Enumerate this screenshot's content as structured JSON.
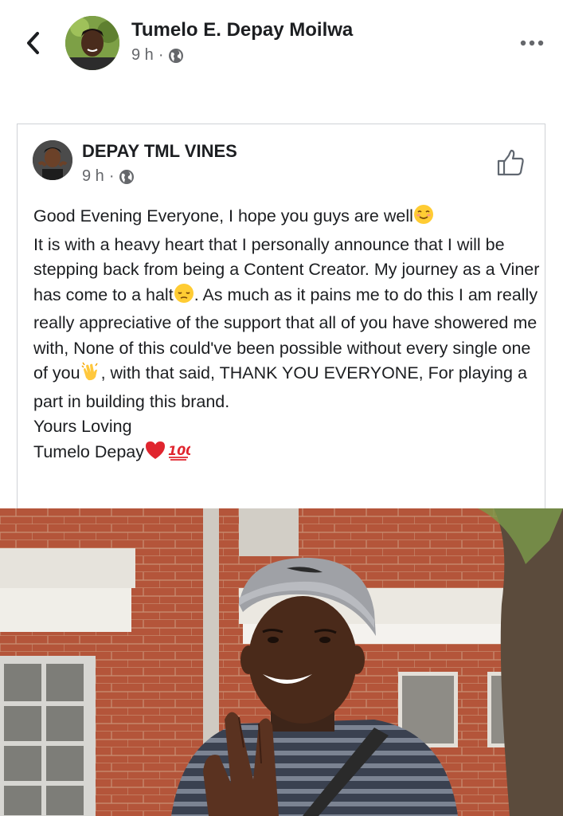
{
  "header": {
    "author": "Tumelo E. Depay Moilwa",
    "time": "9 h",
    "separator": "·",
    "privacy_icon": "globe-icon",
    "back_icon": "chevron-left-icon",
    "more_icon": "more-horizontal-icon"
  },
  "shared_post": {
    "author": "DEPAY TML VINES",
    "time": "9 h",
    "separator": "·",
    "privacy_icon": "globe-icon",
    "like_icon": "thumbs-up-icon",
    "lines": [
      "Good Evening Everyone, I hope you guys are well",
      "It is with a heavy heart that I personally announce that I will be stepping back from being a Content Creator. My journey as a Viner has come to a halt",
      ". As much as it pains me to do this I am really really appreciative of the support that all of you have showered me with, None of this could've been possible without every single one of you",
      ", with that said, THANK YOU EVERYONE, For playing a part in building this brand.",
      "Yours Loving",
      "Tumelo Depay"
    ],
    "emojis": {
      "smile": "smiling-face-emoji",
      "pensive": "pensive-face-emoji",
      "clap": "clapping-hands-emoji",
      "heart": "red-heart-emoji",
      "hundred": "hundred-points-emoji"
    }
  },
  "photo": {
    "subject": "smiling man in grey cap in front of brick building"
  },
  "colors": {
    "text": "#1c1e21",
    "secondary": "#65676b",
    "border": "#cfd2d6",
    "brick": "#b4553a"
  }
}
